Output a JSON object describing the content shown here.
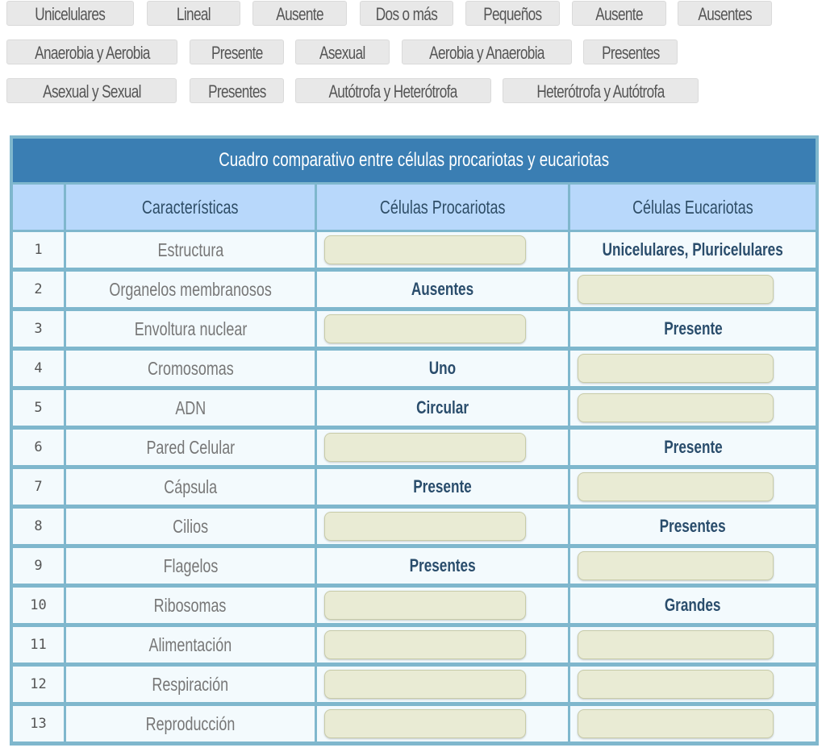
{
  "answer_bank": [
    {
      "label": "Unicelulares"
    },
    {
      "label": "Lineal"
    },
    {
      "label": "Ausente"
    },
    {
      "label": "Dos o más"
    },
    {
      "label": "Pequeños"
    },
    {
      "label": "Ausente"
    },
    {
      "label": "Ausentes"
    },
    {
      "label": "Anaerobia y Aerobia"
    },
    {
      "label": "Presente"
    },
    {
      "label": "Asexual"
    },
    {
      "label": "Aerobia y Anaerobia"
    },
    {
      "label": "Presentes"
    },
    {
      "label": "Asexual y Sexual"
    },
    {
      "label": "Presentes"
    },
    {
      "label": "Autótrofa y Heterótrofa"
    },
    {
      "label": "Heterótrofa y Autótrofa"
    }
  ],
  "table": {
    "title": "Cuadro comparativo entre células procariotas y eucariotas",
    "headers": {
      "number": "",
      "feature": "Características",
      "prokaryote": "Células Procariotas",
      "eukaryote": "Células Eucariotas"
    },
    "rows": [
      {
        "num": "1",
        "feature": "Estructura",
        "prokaryote": null,
        "eukaryote": "Unicelulares, Pluricelulares"
      },
      {
        "num": "2",
        "feature": "Organelos membranosos",
        "prokaryote": "Ausentes",
        "eukaryote": null
      },
      {
        "num": "3",
        "feature": "Envoltura nuclear",
        "prokaryote": null,
        "eukaryote": "Presente"
      },
      {
        "num": "4",
        "feature": "Cromosomas",
        "prokaryote": "Uno",
        "eukaryote": null
      },
      {
        "num": "5",
        "feature": "ADN",
        "prokaryote": "Circular",
        "eukaryote": null
      },
      {
        "num": "6",
        "feature": "Pared Celular",
        "prokaryote": null,
        "eukaryote": "Presente"
      },
      {
        "num": "7",
        "feature": "Cápsula",
        "prokaryote": "Presente",
        "eukaryote": null
      },
      {
        "num": "8",
        "feature": "Cilios",
        "prokaryote": null,
        "eukaryote": "Presentes"
      },
      {
        "num": "9",
        "feature": "Flagelos",
        "prokaryote": "Presentes",
        "eukaryote": null
      },
      {
        "num": "10",
        "feature": "Ribosomas",
        "prokaryote": null,
        "eukaryote": "Grandes"
      },
      {
        "num": "11",
        "feature": "Alimentación",
        "prokaryote": null,
        "eukaryote": null
      },
      {
        "num": "12",
        "feature": "Respiración",
        "prokaryote": null,
        "eukaryote": null
      },
      {
        "num": "13",
        "feature": "Reproducción",
        "prokaryote": null,
        "eukaryote": null
      }
    ]
  }
}
